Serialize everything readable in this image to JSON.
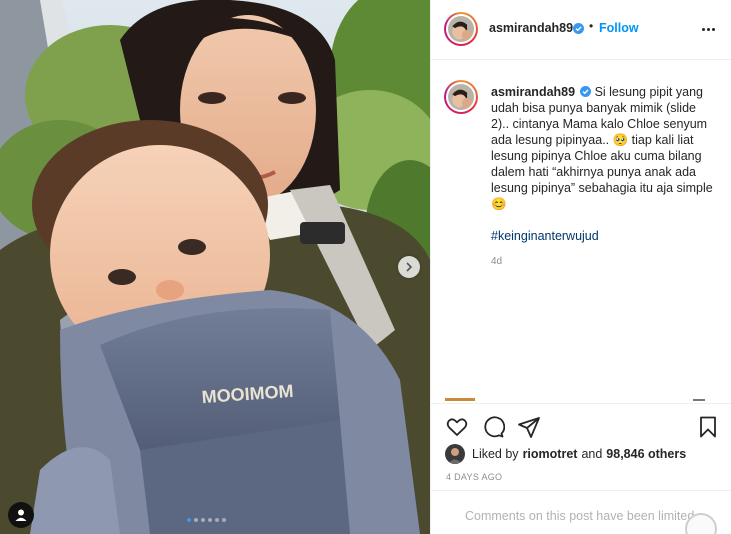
{
  "post": {
    "author": "asmirandah89",
    "follow_label": "Follow",
    "separator": "•",
    "caption_text": "Si lesung pipit yang udah bisa punya banyak mimik (slide 2).. cintanya Mama kalo Chloe senyum ada lesung pipinyaa.. 🥺 tiap kali liat lesung pipinya Chloe aku cuma bilang dalem hati “akhirnya punya anak ada lesung pipinya” sebahagia itu aja simple 😊",
    "hashtag": "#keinginanterwujud",
    "age": "4d",
    "liked_by_prefix": "Liked by",
    "liked_by_user": "riomotret",
    "liked_by_and": "and",
    "liked_by_count": "98,846 others",
    "timestamp": "4 DAYS AGO",
    "comments_limited": "Comments on this post have been limited."
  },
  "media": {
    "brand_text": "MOOIMOM",
    "slide_count": 6,
    "active_slide": 1
  },
  "colors": {
    "accent": "#0095f6",
    "verified": "#3897f0",
    "hashtag": "#00376b",
    "muted": "#8e8e8e",
    "carrier": "#5f6a85"
  },
  "icons": [
    "verified-icon",
    "more-options-icon",
    "chevron-right-icon",
    "user-tag-icon",
    "heart-icon",
    "comment-icon",
    "share-icon",
    "bookmark-icon"
  ]
}
